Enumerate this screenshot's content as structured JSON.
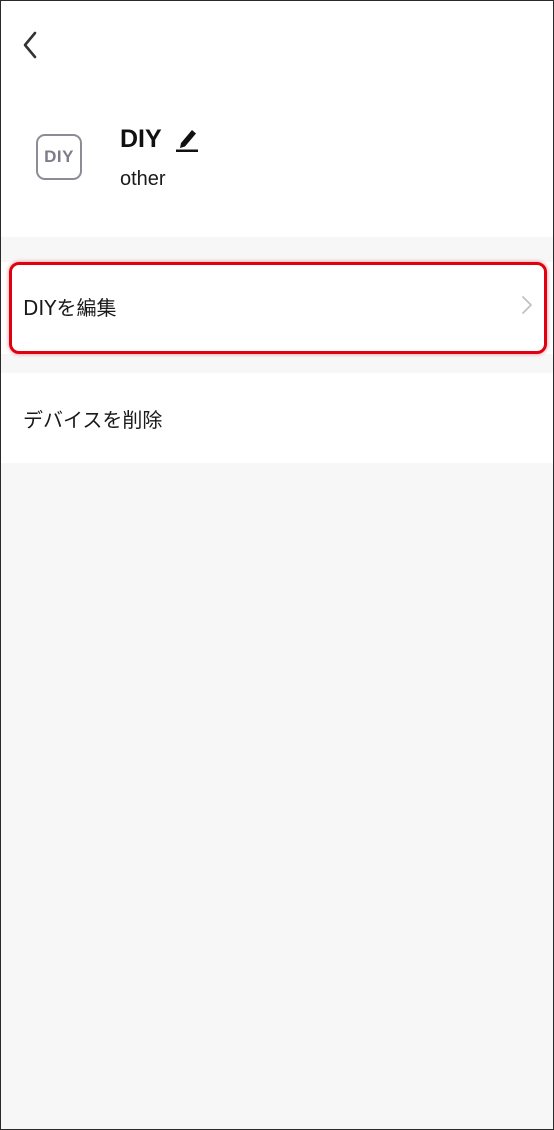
{
  "header": {
    "back_icon": "chevron-left-icon"
  },
  "device": {
    "icon_text": "DIY",
    "name": "DIY",
    "edit_icon": "pencil-icon",
    "category": "other"
  },
  "menu": {
    "items": [
      {
        "label": "DIYを編集",
        "icon": "chevron-right-icon",
        "highlighted": true
      },
      {
        "label": "デバイスを削除"
      }
    ]
  },
  "colors": {
    "highlight": "#e0000f",
    "background": "#f7f7f7",
    "card": "#ffffff",
    "icon_gray": "#8c8c96"
  }
}
